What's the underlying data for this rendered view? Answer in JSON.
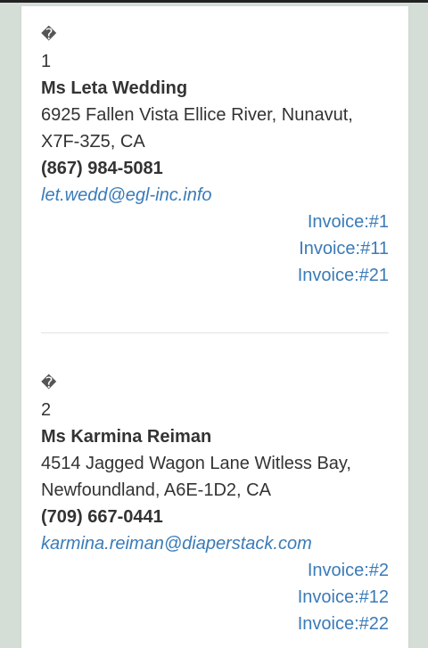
{
  "customers": [
    {
      "icon": "missing-glyph-icon",
      "number": "1",
      "name": "Ms Leta Wedding",
      "address": "6925 Fallen Vista Ellice River, Nunavut, X7F-3Z5, CA",
      "phone": "(867) 984-5081",
      "email": "let.wedd@egl-inc.info",
      "invoices": [
        "Invoice:#1",
        "Invoice:#11",
        "Invoice:#21"
      ]
    },
    {
      "icon": "missing-glyph-icon",
      "number": "2",
      "name": "Ms Karmina Reiman",
      "address": "4514 Jagged Wagon Lane Witless Bay, Newfoundland, A6E-1D2, CA",
      "phone": "(709) 667-0441",
      "email": "karmina.reiman@diaperstack.com",
      "invoices": [
        "Invoice:#2",
        "Invoice:#12",
        "Invoice:#22"
      ]
    }
  ],
  "colors": {
    "background": "#d5ddd7",
    "card": "#ffffff",
    "text": "#333333",
    "link": "#3a7bb8"
  }
}
